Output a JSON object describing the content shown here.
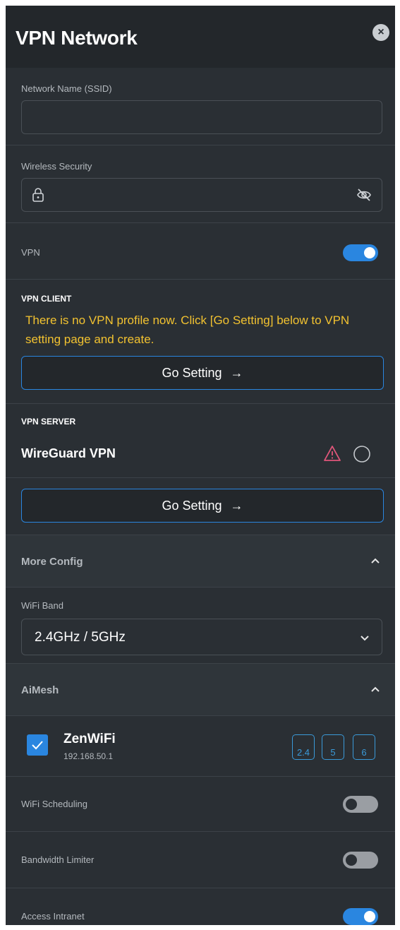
{
  "header": {
    "title": "VPN Network"
  },
  "ssid": {
    "label": "Network Name (SSID)",
    "value": ""
  },
  "security": {
    "label": "Wireless Security",
    "value": ""
  },
  "vpn": {
    "label": "VPN",
    "on": true
  },
  "vpn_client": {
    "heading": "VPN CLIENT",
    "message": "There is no VPN profile now. Click [Go Setting] below to VPN setting page and create.",
    "button_label": "Go Setting",
    "button_arrow": "→"
  },
  "vpn_server": {
    "heading": "VPN SERVER",
    "item_label": "WireGuard VPN",
    "button_label": "Go Setting",
    "button_arrow": "→"
  },
  "more_config": {
    "label": "More Config"
  },
  "wifi_band": {
    "label": "WiFi Band",
    "selected": "2.4GHz / 5GHz"
  },
  "aimesh": {
    "label": "AiMesh",
    "node": {
      "name": "ZenWiFi",
      "ip": "192.168.50.1",
      "checked": true,
      "bands": [
        "2.4",
        "5",
        "6"
      ]
    }
  },
  "wifi_scheduling": {
    "label": "WiFi Scheduling",
    "on": false
  },
  "bandwidth_limiter": {
    "label": "Bandwidth Limiter",
    "on": false
  },
  "access_intranet": {
    "label": "Access Intranet",
    "on": true
  },
  "colors": {
    "accent": "#2a86e0",
    "warning_text": "#f2c230",
    "warning_icon": "#e0567a",
    "panel_bg": "#2a2f34"
  }
}
